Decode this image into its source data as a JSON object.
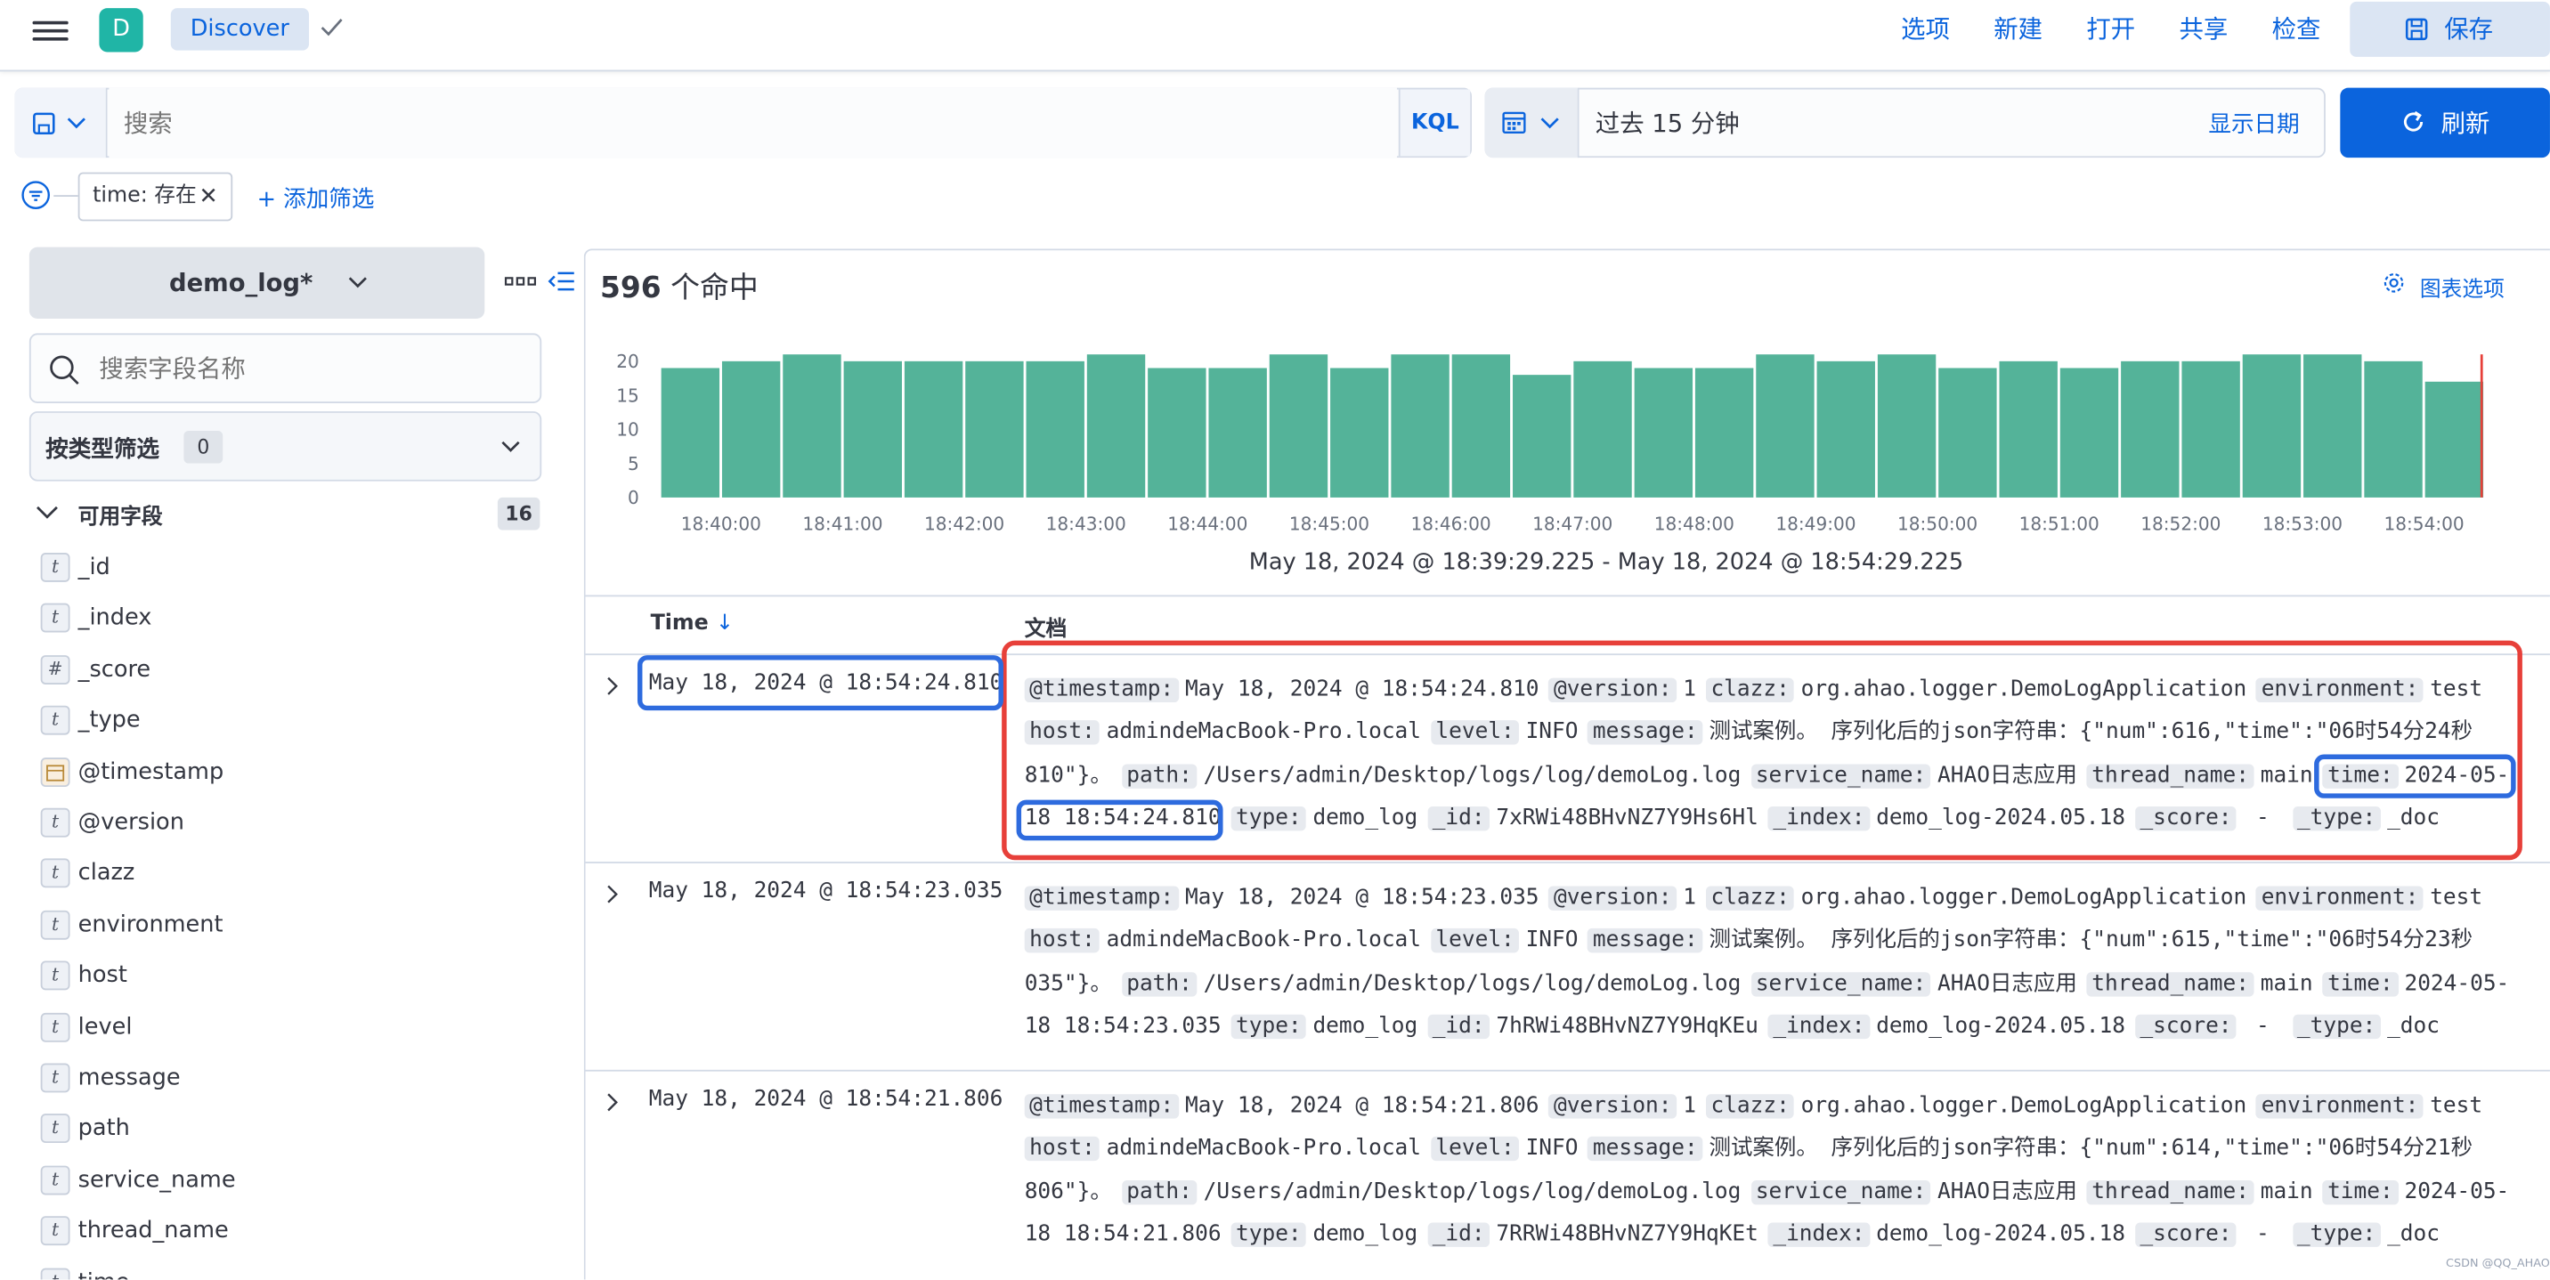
{
  "header": {
    "avatar": "D",
    "breadcrumb": "Discover",
    "nav": [
      "选项",
      "新建",
      "打开",
      "共享",
      "检查"
    ],
    "save_label": "保存"
  },
  "query": {
    "placeholder": "搜索",
    "language": "KQL",
    "date_range": "过去 15 分钟",
    "show_dates": "显示日期",
    "refresh_label": "刷新"
  },
  "filters": {
    "pill": "time: 存在",
    "add_label": "+ 添加筛选"
  },
  "sidebar": {
    "index_pattern": "demo_log*",
    "field_search_placeholder": "搜索字段名称",
    "type_filter_label": "按类型筛选",
    "type_filter_count": "0",
    "available_label": "可用字段",
    "available_count": "16",
    "fields": [
      {
        "type": "t",
        "name": "_id"
      },
      {
        "type": "t",
        "name": "_index"
      },
      {
        "type": "#",
        "name": "_score"
      },
      {
        "type": "t",
        "name": "_type"
      },
      {
        "type": "date",
        "name": "@timestamp"
      },
      {
        "type": "t",
        "name": "@version"
      },
      {
        "type": "t",
        "name": "clazz"
      },
      {
        "type": "t",
        "name": "environment"
      },
      {
        "type": "t",
        "name": "host"
      },
      {
        "type": "t",
        "name": "level"
      },
      {
        "type": "t",
        "name": "message"
      },
      {
        "type": "t",
        "name": "path"
      },
      {
        "type": "t",
        "name": "service_name"
      },
      {
        "type": "t",
        "name": "thread_name"
      },
      {
        "type": "t",
        "name": "time"
      }
    ]
  },
  "main": {
    "hits_count": "596",
    "hits_suffix": "个命中",
    "chart_options": "图表选项",
    "time_range_label": "May 18, 2024 @ 18:39:29.225 - May 18, 2024 @ 18:54:29.225",
    "col_time": "Time",
    "col_time_sort": "↓",
    "col_doc": "文档",
    "rows": [
      {
        "time": "May 18, 2024 @ 18:54:24.810",
        "lines": [
          [
            [
              "@timestamp:",
              "May 18, 2024 @ 18:54:24.810"
            ],
            [
              "@version:",
              "1"
            ],
            [
              "clazz:",
              "org.ahao.logger.DemoLogApplication"
            ],
            [
              "environment:",
              "test"
            ]
          ],
          [
            [
              "host:",
              "admindeMacBook-Pro.local"
            ],
            [
              "level:",
              "INFO"
            ],
            [
              "message:",
              "测试案例。 序列化后的json字符串：{\"num\":616,\"time\":\"06时54分24秒"
            ]
          ],
          [
            [
              "",
              "810\"}。"
            ],
            [
              "path:",
              "/Users/admin/Desktop/logs/log/demoLog.log"
            ],
            [
              "service_name:",
              "AHAO日志应用"
            ],
            [
              "thread_name:",
              "main"
            ],
            [
              "time:",
              "2024-05-"
            ]
          ],
          [
            [
              "",
              "18 18:54:24.810"
            ],
            [
              "type:",
              "demo_log"
            ],
            [
              "_id:",
              "7xRWi48BHvNZ7Y9Hs6Hl"
            ],
            [
              "_index:",
              "demo_log-2024.05.18"
            ],
            [
              "_score:",
              " - "
            ],
            [
              "_type:",
              "_doc"
            ]
          ]
        ]
      },
      {
        "time": "May 18, 2024 @ 18:54:23.035",
        "lines": [
          [
            [
              "@timestamp:",
              "May 18, 2024 @ 18:54:23.035"
            ],
            [
              "@version:",
              "1"
            ],
            [
              "clazz:",
              "org.ahao.logger.DemoLogApplication"
            ],
            [
              "environment:",
              "test"
            ]
          ],
          [
            [
              "host:",
              "admindeMacBook-Pro.local"
            ],
            [
              "level:",
              "INFO"
            ],
            [
              "message:",
              "测试案例。 序列化后的json字符串：{\"num\":615,\"time\":\"06时54分23秒"
            ]
          ],
          [
            [
              "",
              "035\"}。"
            ],
            [
              "path:",
              "/Users/admin/Desktop/logs/log/demoLog.log"
            ],
            [
              "service_name:",
              "AHAO日志应用"
            ],
            [
              "thread_name:",
              "main"
            ],
            [
              "time:",
              "2024-05-"
            ]
          ],
          [
            [
              "",
              "18 18:54:23.035"
            ],
            [
              "type:",
              "demo_log"
            ],
            [
              "_id:",
              "7hRWi48BHvNZ7Y9HqKEu"
            ],
            [
              "_index:",
              "demo_log-2024.05.18"
            ],
            [
              "_score:",
              " - "
            ],
            [
              "_type:",
              "_doc"
            ]
          ]
        ]
      },
      {
        "time": "May 18, 2024 @ 18:54:21.806",
        "lines": [
          [
            [
              "@timestamp:",
              "May 18, 2024 @ 18:54:21.806"
            ],
            [
              "@version:",
              "1"
            ],
            [
              "clazz:",
              "org.ahao.logger.DemoLogApplication"
            ],
            [
              "environment:",
              "test"
            ]
          ],
          [
            [
              "host:",
              "admindeMacBook-Pro.local"
            ],
            [
              "level:",
              "INFO"
            ],
            [
              "message:",
              "测试案例。 序列化后的json字符串：{\"num\":614,\"time\":\"06时54分21秒"
            ]
          ],
          [
            [
              "",
              "806\"}。"
            ],
            [
              "path:",
              "/Users/admin/Desktop/logs/log/demoLog.log"
            ],
            [
              "service_name:",
              "AHAO日志应用"
            ],
            [
              "thread_name:",
              "main"
            ],
            [
              "time:",
              "2024-05-"
            ]
          ],
          [
            [
              "",
              "18 18:54:21.806"
            ],
            [
              "type:",
              "demo_log"
            ],
            [
              "_id:",
              "7RRWi48BHvNZ7Y9HqKEt"
            ],
            [
              "_index:",
              "demo_log-2024.05.18"
            ],
            [
              "_score:",
              " - "
            ],
            [
              "_type:",
              "_doc"
            ]
          ]
        ]
      }
    ]
  },
  "watermark": "CSDN @QQ_AHAO",
  "colors": {
    "accent": "#0b64dd",
    "bar": "#54b399",
    "highlight_red": "#e7403a",
    "highlight_blue": "#2e6bde"
  },
  "chart_data": {
    "type": "bar",
    "x_ticks": [
      "18:40:00",
      "18:41:00",
      "18:42:00",
      "18:43:00",
      "18:44:00",
      "18:45:00",
      "18:46:00",
      "18:47:00",
      "18:48:00",
      "18:49:00",
      "18:50:00",
      "18:51:00",
      "18:52:00",
      "18:53:00",
      "18:54:00"
    ],
    "y_ticks": [
      0,
      5,
      10,
      15,
      20
    ],
    "values": [
      19,
      20,
      21,
      20,
      20,
      20,
      20,
      21,
      19,
      19,
      21,
      19,
      21,
      21,
      18,
      20,
      19,
      19,
      21,
      20,
      21,
      19,
      20,
      19,
      20,
      20,
      21,
      21,
      20,
      17
    ],
    "ylim": [
      0,
      20
    ],
    "grid": false
  }
}
